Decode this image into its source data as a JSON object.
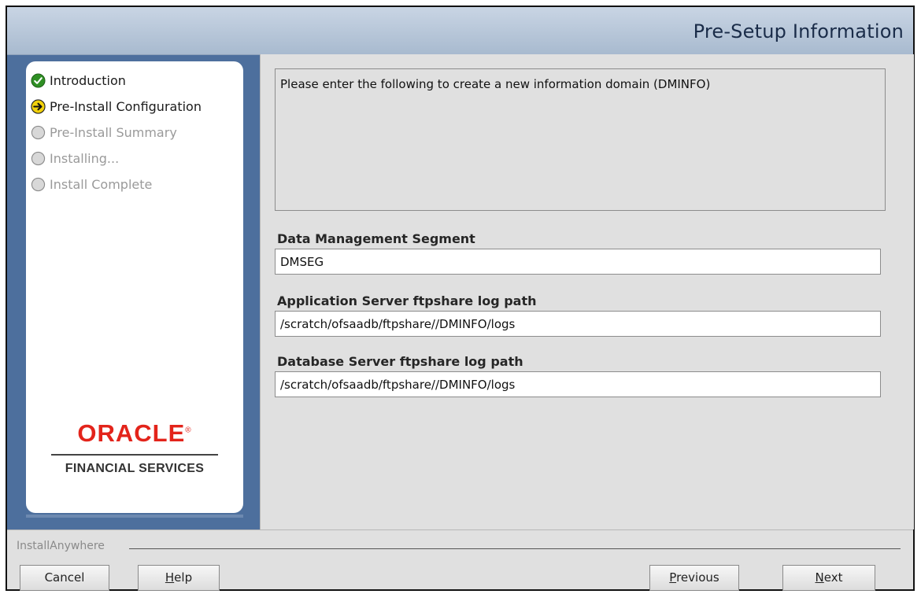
{
  "header": {
    "title": "Pre-Setup Information"
  },
  "sidebar": {
    "steps": [
      {
        "label": "Introduction",
        "state": "done",
        "icon": "check-circle-icon"
      },
      {
        "label": "Pre-Install Configuration",
        "state": "current",
        "icon": "arrow-circle-icon"
      },
      {
        "label": "Pre-Install Summary",
        "state": "pending",
        "icon": "empty-circle-icon"
      },
      {
        "label": "Installing...",
        "state": "pending",
        "icon": "empty-circle-icon"
      },
      {
        "label": "Install Complete",
        "state": "pending",
        "icon": "empty-circle-icon"
      }
    ],
    "logo": {
      "brand": "ORACLE",
      "registered_mark": "®",
      "subtitle": "FINANCIAL SERVICES"
    }
  },
  "content": {
    "instructions": "Please enter the following to create a new information domain (DMINFO)",
    "fields": [
      {
        "label": "Data Management Segment",
        "value": "DMSEG"
      },
      {
        "label": "Application Server ftpshare log path",
        "value": "/scratch/ofsaadb/ftpshare//DMINFO/logs"
      },
      {
        "label": "Database Server ftpshare log path",
        "value": "/scratch/ofsaadb/ftpshare//DMINFO/logs"
      }
    ]
  },
  "footer": {
    "brand": "InstallAnywhere",
    "buttons": {
      "cancel": {
        "label": "Cancel"
      },
      "help": {
        "mnemonic": "H",
        "rest": "elp"
      },
      "previous": {
        "mnemonic": "P",
        "rest": "revious"
      },
      "next": {
        "mnemonic": "N",
        "rest": "ext"
      }
    }
  },
  "colors": {
    "frame_blue": "#4d6f9d",
    "header_text": "#1a2c49",
    "oracle_red": "#e3241b",
    "check_green": "#2f8f24",
    "arrow_yellow": "#f2d10a"
  }
}
